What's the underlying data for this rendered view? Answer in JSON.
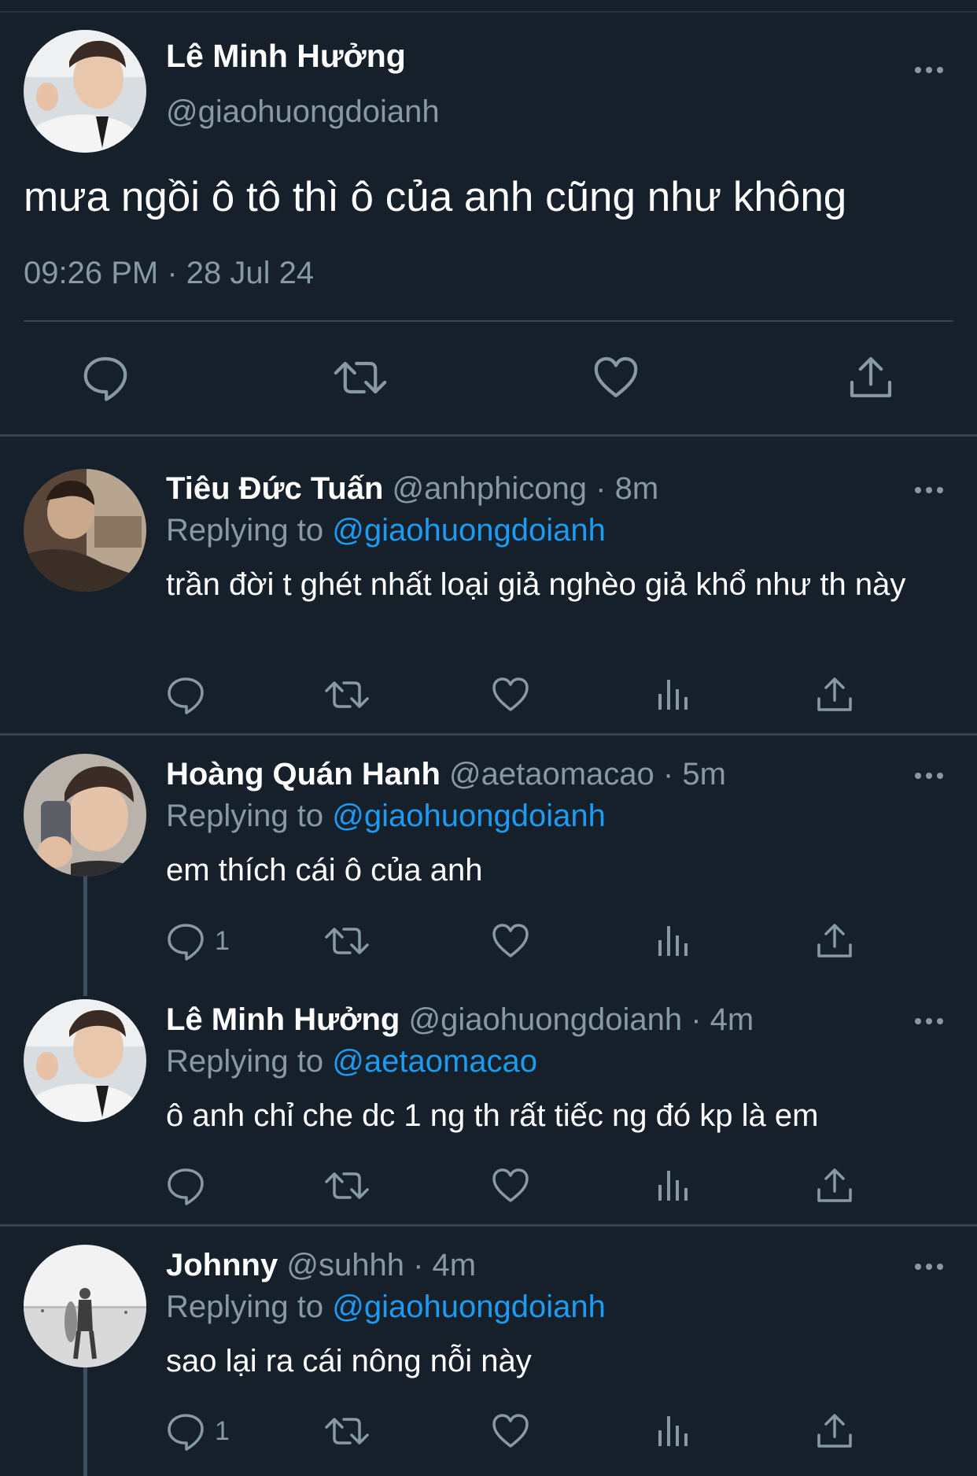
{
  "main_tweet": {
    "name": "Lê Minh Hưởng",
    "handle": "@giaohuongdoianh",
    "text": "mưa ngồi ô tô thì ô của anh cũng như không",
    "timestamp": "09:26 PM · 28 Jul 24"
  },
  "replies": [
    {
      "name": "Tiêu Đức Tuấn",
      "handle": "@anhphicong",
      "time": "8m",
      "replying_prefix": "Replying to",
      "replying_to": "@giaohuongdoianh",
      "text": "trần đời t ghét nhất loại giả nghèo giả khổ như th này",
      "reply_count": ""
    },
    {
      "name": "Hoàng Quán Hanh",
      "handle": "@aetaomacao",
      "time": "5m",
      "replying_prefix": "Replying to",
      "replying_to": "@giaohuongdoianh",
      "text": "em thích cái ô của anh",
      "reply_count": "1"
    },
    {
      "name": "Lê Minh Hưởng",
      "handle": "@giaohuongdoianh",
      "time": "4m",
      "replying_prefix": "Replying to",
      "replying_to": "@aetaomacao",
      "text": "ô anh chỉ che dc 1 ng th rất tiếc ng đó kp là em",
      "reply_count": ""
    },
    {
      "name": "Johnny",
      "handle": "@suhhh",
      "time": "4m",
      "replying_prefix": "Replying to",
      "replying_to": "@giaohuongdoianh",
      "text": "sao lại ra cái nông nỗi này",
      "reply_count": "1"
    }
  ],
  "separator": "·",
  "icons": [
    "more-icon",
    "reply-icon",
    "retweet-icon",
    "like-icon",
    "analytics-icon",
    "share-icon"
  ],
  "colors": {
    "background": "#15202b",
    "secondary_text": "#8899a6",
    "link": "#1d9bf0",
    "divider": "#38444d"
  }
}
